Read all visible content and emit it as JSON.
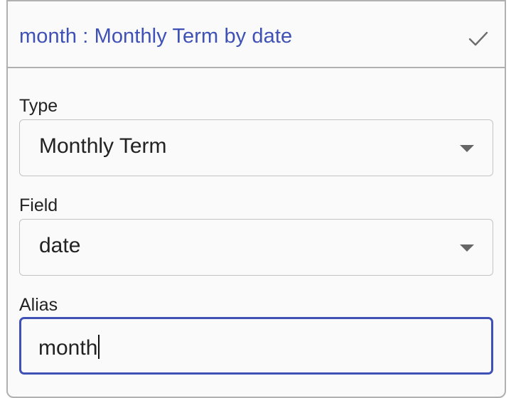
{
  "header": {
    "title": "month : Monthly Term by date",
    "confirm_icon": "check-icon"
  },
  "fields": {
    "type": {
      "label": "Type",
      "value": "Monthly Term"
    },
    "field": {
      "label": "Field",
      "value": "date"
    },
    "alias": {
      "label": "Alias",
      "value": "month"
    }
  },
  "colors": {
    "accent": "#3f51b5",
    "border": "#b0b0b0",
    "text": "#222222"
  }
}
